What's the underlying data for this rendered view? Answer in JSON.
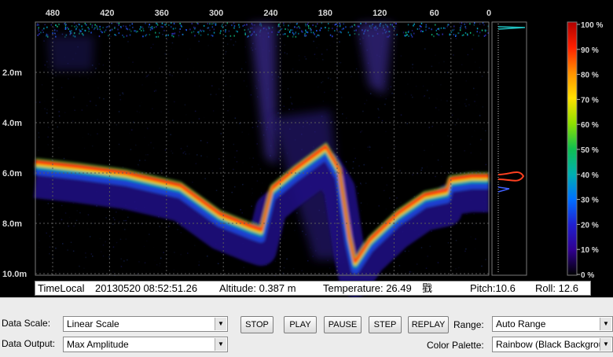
{
  "top_axis_ticks": [
    "480",
    "420",
    "360",
    "300",
    "240",
    "180",
    "120",
    "60",
    "0"
  ],
  "depth_ticks": [
    "2.0m",
    "4.0m",
    "6.0m",
    "8.0m",
    "10.0m"
  ],
  "color_scale": {
    "labels": [
      "100 %",
      "90 %",
      "80 %",
      "70 %",
      "60 %",
      "50 %",
      "40 %",
      "30 %",
      "20 %",
      "10 %",
      "0 %"
    ],
    "colors": [
      "#b00000",
      "#ff2000",
      "#ff9000",
      "#ffe000",
      "#90e000",
      "#10c050",
      "#00b0b0",
      "#0070ff",
      "#2020d0",
      "#300090",
      "#000000"
    ]
  },
  "status": {
    "time_label": "TimeLocal",
    "datetime": "20130520 08:52:51.26",
    "altitude": "Altitude: 0.387 m",
    "temperature": "Temperature: 26.49",
    "temperature_unit": "戥",
    "pitch": "Pitch:10.6",
    "roll": "Roll: 12.6"
  },
  "controls": {
    "data_scale_label": "Data Scale:",
    "data_scale_value": "Linear Scale",
    "data_output_label": "Data Output:",
    "data_output_value": "Max  Amplitude",
    "buttons": [
      "STOP",
      "PLAY",
      "PAUSE",
      "STEP",
      "REPLAY"
    ],
    "range_label": "Range:",
    "range_value": "Auto Range",
    "palette_label": "Color Palette:",
    "palette_value": "Rainbow (Black Backgrour"
  }
}
